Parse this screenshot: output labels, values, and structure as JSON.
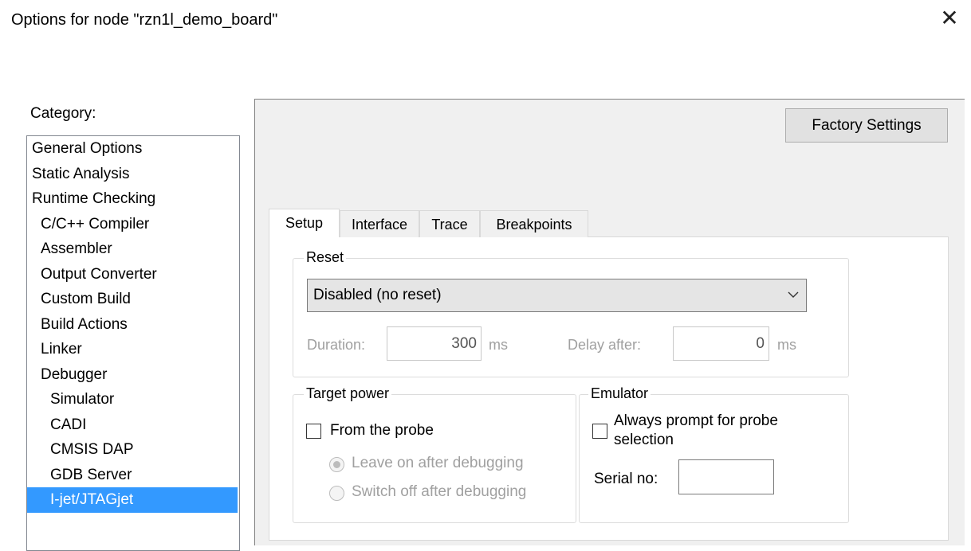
{
  "window": {
    "title": "Options for node \"rzn1l_demo_board\"",
    "close_glyph": "✕"
  },
  "category": {
    "label": "Category:",
    "items": [
      {
        "label": "General Options",
        "level": 0,
        "selected": false
      },
      {
        "label": "Static Analysis",
        "level": 0,
        "selected": false
      },
      {
        "label": "Runtime Checking",
        "level": 0,
        "selected": false
      },
      {
        "label": "C/C++ Compiler",
        "level": 1,
        "selected": false
      },
      {
        "label": "Assembler",
        "level": 1,
        "selected": false
      },
      {
        "label": "Output Converter",
        "level": 1,
        "selected": false
      },
      {
        "label": "Custom Build",
        "level": 1,
        "selected": false
      },
      {
        "label": "Build Actions",
        "level": 1,
        "selected": false
      },
      {
        "label": "Linker",
        "level": 1,
        "selected": false
      },
      {
        "label": "Debugger",
        "level": 1,
        "selected": false
      },
      {
        "label": "Simulator",
        "level": 2,
        "selected": false
      },
      {
        "label": "CADI",
        "level": 2,
        "selected": false
      },
      {
        "label": "CMSIS DAP",
        "level": 2,
        "selected": false
      },
      {
        "label": "GDB Server",
        "level": 2,
        "selected": false
      },
      {
        "label": "I-jet/JTAGjet",
        "level": 2,
        "selected": true
      }
    ],
    "selected_color": "#3399ff"
  },
  "factory_settings_label": "Factory Settings",
  "tabs": [
    {
      "label": "Setup",
      "active": true
    },
    {
      "label": "Interface",
      "active": false
    },
    {
      "label": "Trace",
      "active": false
    },
    {
      "label": "Breakpoints",
      "active": false
    }
  ],
  "reset": {
    "legend": "Reset",
    "selected_option": "Disabled (no reset)",
    "duration_label": "Duration:",
    "duration_value": "300",
    "duration_unit": "ms",
    "delay_label": "Delay after:",
    "delay_value": "0",
    "delay_unit": "ms"
  },
  "target_power": {
    "legend": "Target power",
    "from_probe_label": "From the probe",
    "from_probe_checked": false,
    "leave_on_label": "Leave on after debugging",
    "leave_on_selected": true,
    "switch_off_label": "Switch off after debugging",
    "switch_off_selected": false
  },
  "emulator": {
    "legend": "Emulator",
    "always_prompt_label_line1": "Always prompt for probe",
    "always_prompt_label_line2": "selection",
    "always_prompt_checked": false,
    "serial_label": "Serial no:",
    "serial_value": ""
  }
}
